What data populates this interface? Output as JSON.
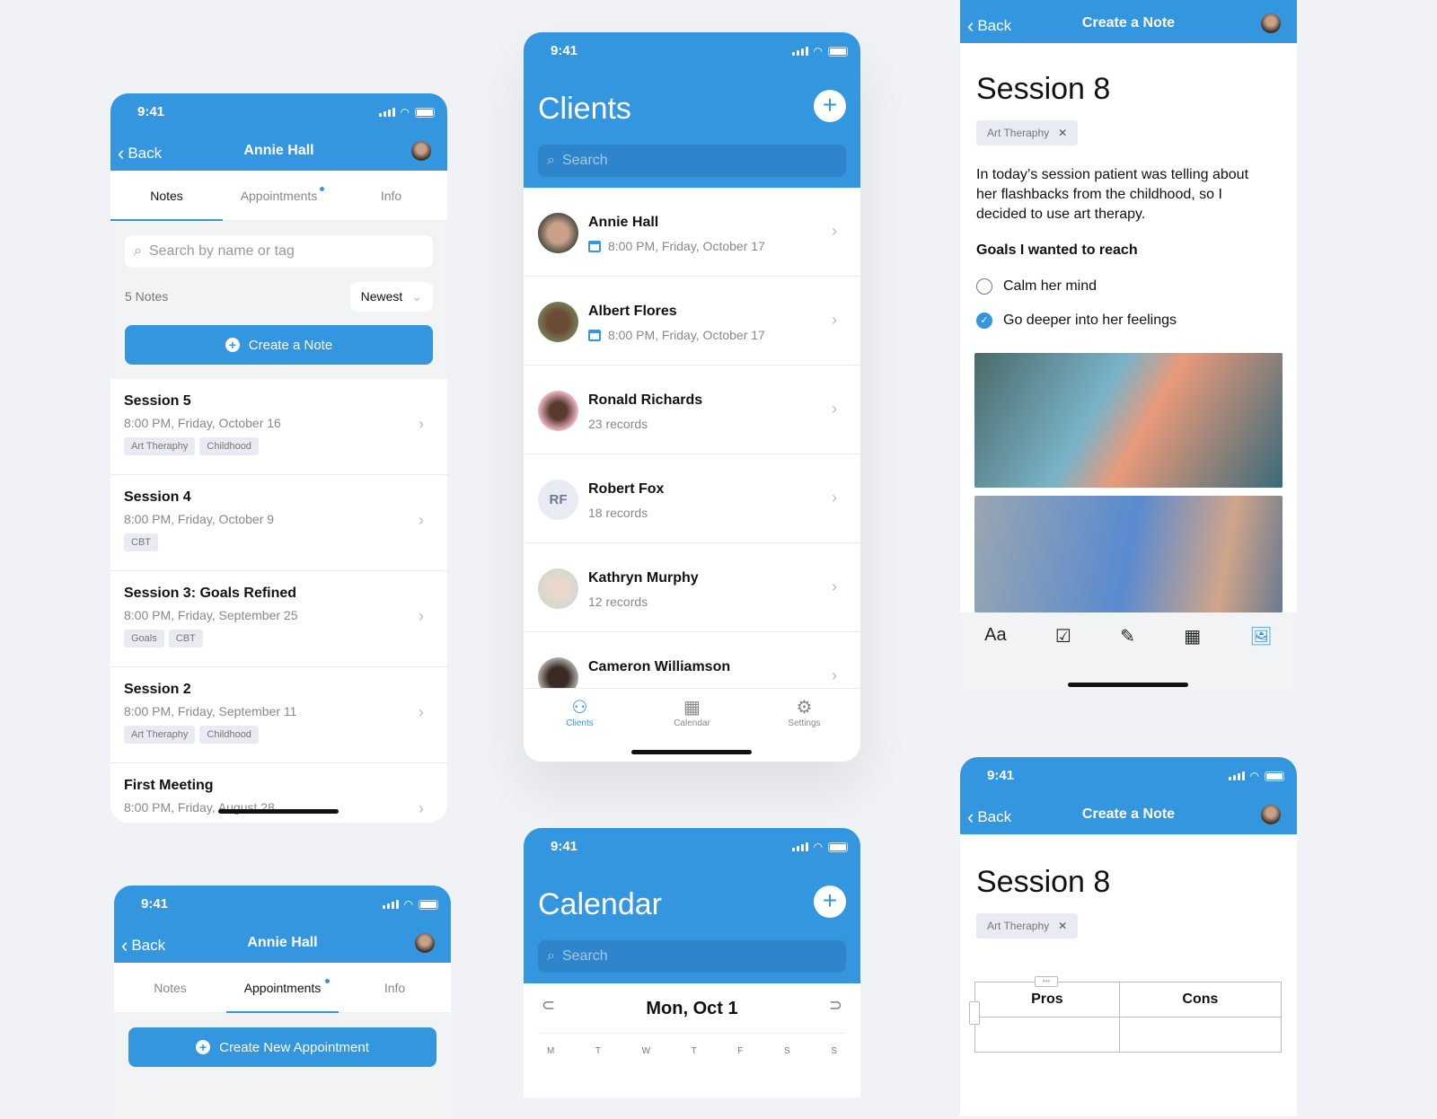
{
  "status_time": "9:41",
  "colors": {
    "accent": "#3596e0",
    "background": "#f0f2f5"
  },
  "notes_screen": {
    "back_label": "Back",
    "title": "Annie Hall",
    "tabs": [
      {
        "label": "Notes",
        "active": true
      },
      {
        "label": "Appointments",
        "badge": true
      },
      {
        "label": "Info"
      }
    ],
    "search_placeholder": "Search by name or tag",
    "count_label": "5 Notes",
    "sort_label": "Newest",
    "create_button": "Create a Note",
    "notes": [
      {
        "title": "Session 5",
        "date": "8:00 PM, Friday, October 16",
        "tags": [
          "Art Theraphy",
          "Childhood"
        ]
      },
      {
        "title": "Session 4",
        "date": "8:00 PM, Friday, October 9",
        "tags": [
          "CBT"
        ]
      },
      {
        "title": "Session 3: Goals Refined",
        "date": "8:00 PM, Friday, September 25",
        "tags": [
          "Goals",
          "CBT"
        ]
      },
      {
        "title": "Session 2",
        "date": "8:00 PM, Friday, September 11",
        "tags": [
          "Art Theraphy",
          "Childhood"
        ]
      },
      {
        "title": "First Meeting",
        "date": "8:00 PM, Friday, August 28",
        "tags": []
      }
    ]
  },
  "clients_screen": {
    "title": "Clients",
    "search_placeholder": "Search",
    "clients": [
      {
        "name": "Annie Hall",
        "sub": "8:00 PM, Friday, October 17",
        "calendar": true
      },
      {
        "name": "Albert Flores",
        "sub": "8:00 PM, Friday, October 17",
        "calendar": true
      },
      {
        "name": "Ronald Richards",
        "sub": "23 records"
      },
      {
        "name": "Robert Fox",
        "sub": "18 records",
        "initials": "RF"
      },
      {
        "name": "Kathryn Murphy",
        "sub": "12 records"
      },
      {
        "name": "Cameron Williamson",
        "sub": ""
      }
    ],
    "bottom_nav": [
      {
        "label": "Clients",
        "icon": "users-icon",
        "active": true
      },
      {
        "label": "Calendar",
        "icon": "calendar-icon"
      },
      {
        "label": "Settings",
        "icon": "gear-icon"
      }
    ]
  },
  "note_editor": {
    "back_label": "Back",
    "title": "Create a Note",
    "note_title": "Session 8",
    "tag": "Art Theraphy",
    "body": "In today’s session patient was telling about her flashbacks from the childhood, so I decided to use art therapy.",
    "goals_heading": "Goals I wanted to reach",
    "goals": [
      {
        "label": "Calm her mind",
        "checked": false
      },
      {
        "label": "Go deeper into her feelings",
        "checked": true
      }
    ],
    "toolbar": [
      "text-format-icon",
      "checklist-icon",
      "highlighter-icon",
      "table-icon",
      "image-icon"
    ],
    "toolbar_text_label": "Aa"
  },
  "appointments_screen": {
    "back_label": "Back",
    "title": "Annie Hall",
    "tabs": [
      {
        "label": "Notes"
      },
      {
        "label": "Appointments",
        "active": true,
        "badge": true
      },
      {
        "label": "Info"
      }
    ],
    "create_button": "Create New Appointment"
  },
  "calendar_screen": {
    "title": "Calendar",
    "search_placeholder": "Search",
    "date_label": "Mon, Oct 1",
    "weekdays": [
      "M",
      "T",
      "W",
      "T",
      "F",
      "S",
      "S"
    ]
  },
  "table_editor": {
    "back_label": "Back",
    "title": "Create a Note",
    "note_title": "Session 8",
    "tag": "Art Theraphy",
    "table_headers": [
      "Pros",
      "Cons"
    ]
  }
}
